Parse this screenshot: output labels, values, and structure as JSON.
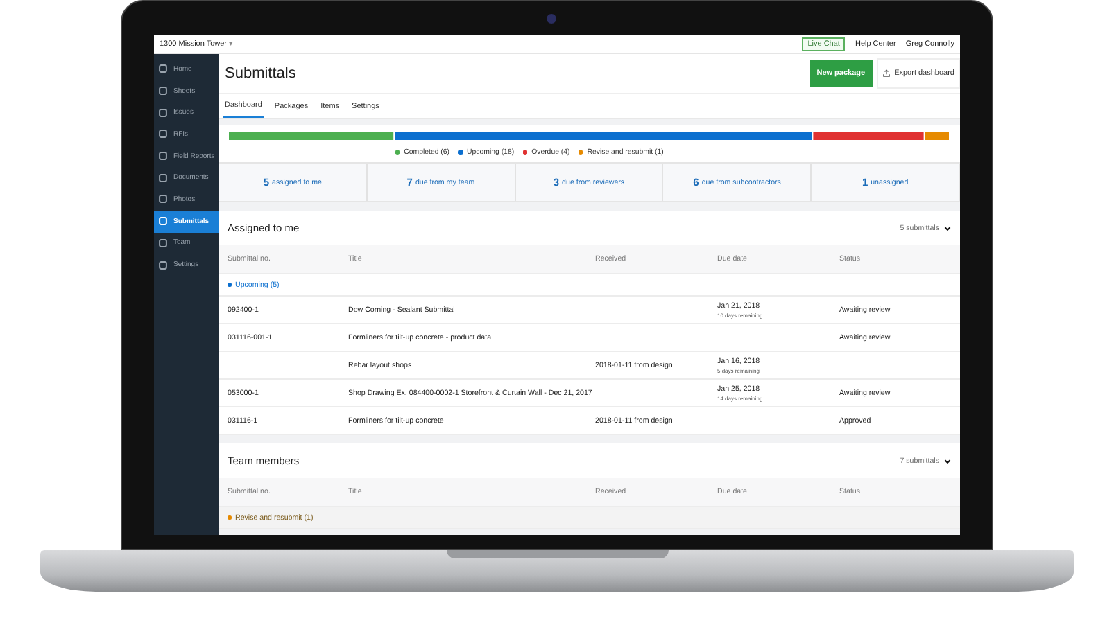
{
  "topbar": {
    "project": "1300 Mission Tower",
    "project_caret": "▾",
    "links": [
      {
        "label": "Live Chat",
        "kind": "outlined"
      },
      {
        "label": "Help Center",
        "kind": "plain"
      },
      {
        "label": "Greg Connolly",
        "kind": "menu"
      }
    ]
  },
  "sidebar": {
    "items": [
      {
        "label": "Home",
        "selected": false
      },
      {
        "label": "Sheets",
        "selected": false
      },
      {
        "label": "Issues",
        "selected": false
      },
      {
        "label": "RFIs",
        "selected": false
      },
      {
        "label": "Field Reports",
        "selected": false
      },
      {
        "label": "Documents",
        "selected": false
      },
      {
        "label": "Photos",
        "selected": false
      },
      {
        "label": "Submittals",
        "selected": true
      },
      {
        "label": "Team",
        "selected": false
      },
      {
        "label": "Settings",
        "selected": false
      }
    ]
  },
  "header": {
    "title": "Submittals",
    "primary_button": "New package",
    "export_button": "Export dashboard"
  },
  "tabs": [
    {
      "label": "Dashboard",
      "selected": true
    },
    {
      "label": "Packages",
      "selected": false
    },
    {
      "label": "Items",
      "selected": false
    },
    {
      "label": "Settings",
      "selected": false
    }
  ],
  "status_overview": {
    "legend": [
      {
        "label": "Completed (6)",
        "color": "#4caf50"
      },
      {
        "label": "Upcoming (18)",
        "color": "#0b6fcf"
      },
      {
        "label": "Overdue (4)",
        "color": "#e03131"
      },
      {
        "label": "Revise and resubmit (1)",
        "color": "#e68a00"
      }
    ]
  },
  "summary": [
    {
      "count": "5",
      "label": "assigned to me"
    },
    {
      "count": "7",
      "label": "due from my team"
    },
    {
      "count": "3",
      "label": "due from reviewers"
    },
    {
      "count": "6",
      "label": "due from subcontractors"
    },
    {
      "count": "1",
      "label": "unassigned"
    }
  ],
  "sections": [
    {
      "title": "Assigned to me",
      "count": "5 submittals",
      "columns": [
        "Submittal no.",
        "Title",
        "Received",
        "Due date",
        "Status"
      ],
      "group": {
        "label": "Upcoming (5)",
        "color": "#0b6fcf"
      },
      "rows": [
        {
          "number": "092400-1",
          "title": "Dow Corning - Sealant Submittal",
          "due": "Jan 21, 2018",
          "remaining": "10 days remaining",
          "status": "Awaiting review"
        },
        {
          "number": "031116-001-1",
          "title": "Formliners for tilt-up concrete - product data",
          "status": "Awaiting review"
        },
        {
          "title": "Rebar layout shops",
          "received": "2018-01-11 from design",
          "due": "Jan 16, 2018",
          "remaining": "5 days remaining"
        },
        {
          "number": "053000-1",
          "title": "Shop Drawing Ex. 084400-0002-1 Storefront & Curtain Wall - Dec 21, 2017",
          "due": "Jan 25, 2018",
          "remaining": "14 days remaining",
          "status": "Awaiting review"
        },
        {
          "number": "031116-1",
          "title": "Formliners for tilt-up concrete",
          "received": "2018-01-11 from design",
          "status": "Approved"
        }
      ]
    },
    {
      "title": "Team members",
      "count": "7 submittals",
      "columns": [
        "Submittal no.",
        "Title",
        "Received",
        "Due date",
        "Status"
      ],
      "group": {
        "label": "Revise and resubmit (1)",
        "color": "#e68a00"
      }
    }
  ]
}
